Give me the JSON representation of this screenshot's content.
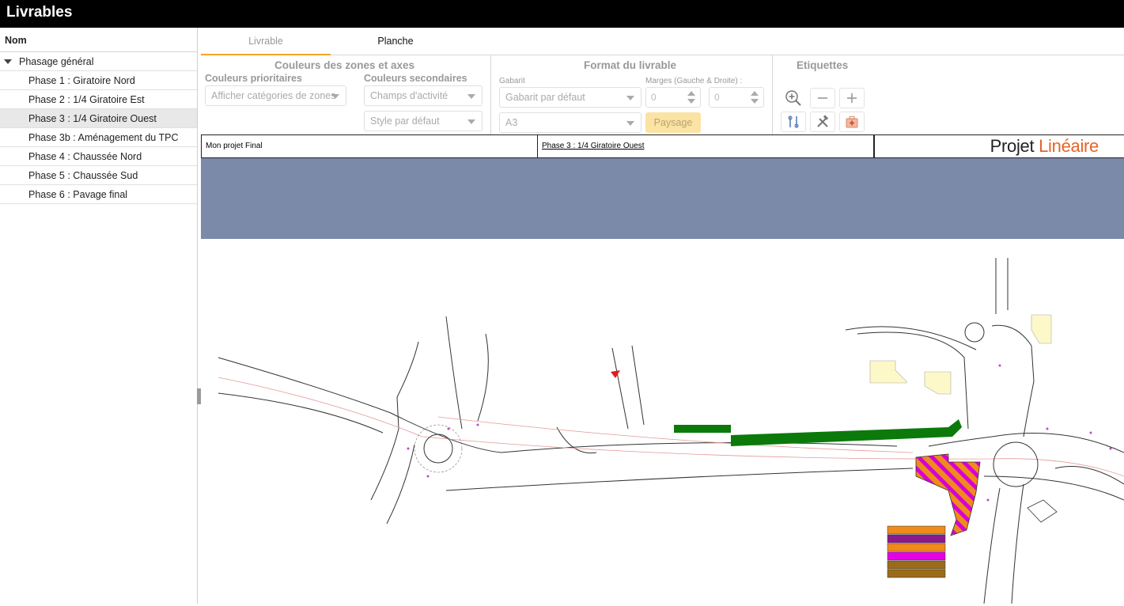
{
  "app": {
    "title": "Livrables"
  },
  "sidebar": {
    "column_header": "Nom",
    "group_label": "Phasage général",
    "items": [
      {
        "label": "Phase 1 : Giratoire Nord"
      },
      {
        "label": "Phase 2 : 1/4 Giratoire Est"
      },
      {
        "label": "Phase 3 : 1/4 Giratoire Ouest"
      },
      {
        "label": "Phase 3b : Aménagement du TPC"
      },
      {
        "label": "Phase 4 : Chaussée Nord"
      },
      {
        "label": "Phase 5 : Chaussée Sud"
      },
      {
        "label": "Phase 6 : Pavage final"
      }
    ],
    "selected_index": 2
  },
  "tabs": [
    {
      "label": "Livrable"
    },
    {
      "label": "Planche"
    }
  ],
  "ribbon": {
    "colors_group": {
      "title": "Couleurs des zones et axes",
      "primary_label": "Couleurs prioritaires",
      "primary_value": "Afficher catégories de zones",
      "secondary_label": "Couleurs secondaires",
      "secondary_value": "Champs d'activité",
      "style_value": "Style par défaut"
    },
    "format_group": {
      "title": "Format du livrable",
      "gabarit_label": "Gabarit",
      "gabarit_value": "Gabarit par défaut",
      "paper_value": "A3",
      "margins_label": "Marges (Gauche & Droite) :",
      "margin_left": "0",
      "margin_right": "0",
      "orientation_button": "Paysage"
    },
    "labels_group": {
      "title": "Etiquettes"
    }
  },
  "sheet": {
    "project_name": "Mon projet Final",
    "phase_name": "Phase 3 : 1/4 Giratoire Ouest",
    "logo_part1": "Projet",
    "logo_part2": "Linéaire"
  },
  "colors": {
    "banner": "#7b8aa8",
    "accent_tab": "#f3a52a",
    "green_zone": "#0b7a0b",
    "hatch_orange": "#f08a1c",
    "hatch_magenta": "#d400d4",
    "logo_accent": "#e5642a"
  },
  "icons": [
    "zoom-in-icon",
    "minus-icon",
    "plus-icon",
    "tools-icon",
    "hammer-wrench-icon",
    "first-aid-kit-icon"
  ]
}
